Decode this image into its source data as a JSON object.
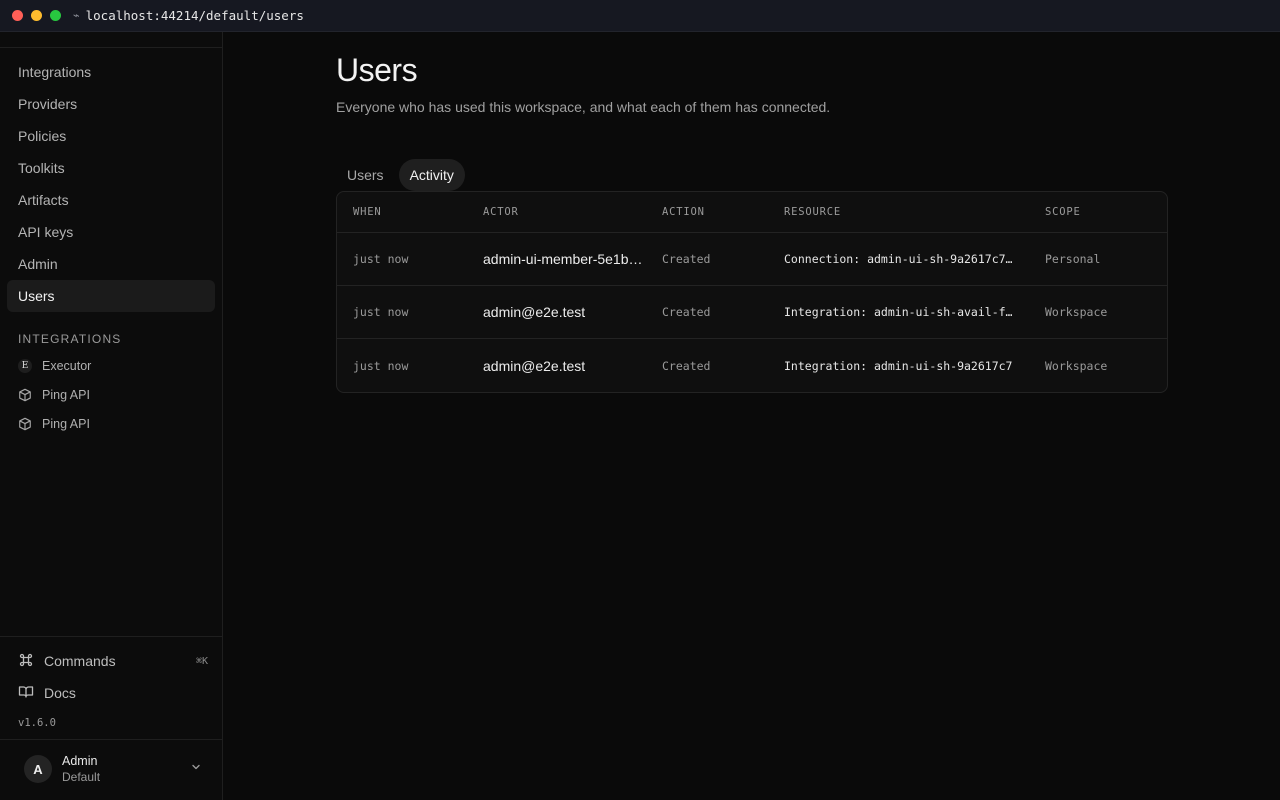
{
  "browser": {
    "url": "localhost:44214/default/users",
    "traffic_colors": [
      "#ff5f57",
      "#febc2e",
      "#28c840"
    ]
  },
  "sidebar": {
    "nav": [
      {
        "label": "Integrations"
      },
      {
        "label": "Providers"
      },
      {
        "label": "Policies"
      },
      {
        "label": "Toolkits"
      },
      {
        "label": "Artifacts"
      },
      {
        "label": "API keys"
      },
      {
        "label": "Admin"
      },
      {
        "label": "Users",
        "active": true
      }
    ],
    "integrations_title": "INTEGRATIONS",
    "integrations": [
      {
        "label": "Executor",
        "icon": "executor-logo-icon",
        "glyph": "E"
      },
      {
        "label": "Ping API",
        "icon": "package-icon"
      },
      {
        "label": "Ping API",
        "icon": "package-icon"
      }
    ],
    "commands_label": "Commands",
    "commands_shortcut": "⌘K",
    "docs_label": "Docs",
    "version": "v1.6.0",
    "account": {
      "initial": "A",
      "name": "Admin",
      "workspace": "Default"
    }
  },
  "main": {
    "title": "Users",
    "subtitle": "Everyone who has used this workspace, and what each of them has connected.",
    "tabs": [
      {
        "label": "Users",
        "active": false
      },
      {
        "label": "Activity",
        "active": true
      }
    ],
    "table": {
      "columns": [
        "WHEN",
        "ACTOR",
        "ACTION",
        "RESOURCE",
        "SCOPE"
      ],
      "rows": [
        {
          "when": "just now",
          "actor": "admin-ui-member-5e1b…",
          "action": "Created",
          "resource": "Connection: admin-ui-sh-9a2617c7…",
          "scope": "Personal"
        },
        {
          "when": "just now",
          "actor": "admin@e2e.test",
          "action": "Created",
          "resource": "Integration: admin-ui-sh-avail-f…",
          "scope": "Workspace"
        },
        {
          "when": "just now",
          "actor": "admin@e2e.test",
          "action": "Created",
          "resource": "Integration: admin-ui-sh-9a2617c7",
          "scope": "Workspace"
        }
      ]
    }
  }
}
